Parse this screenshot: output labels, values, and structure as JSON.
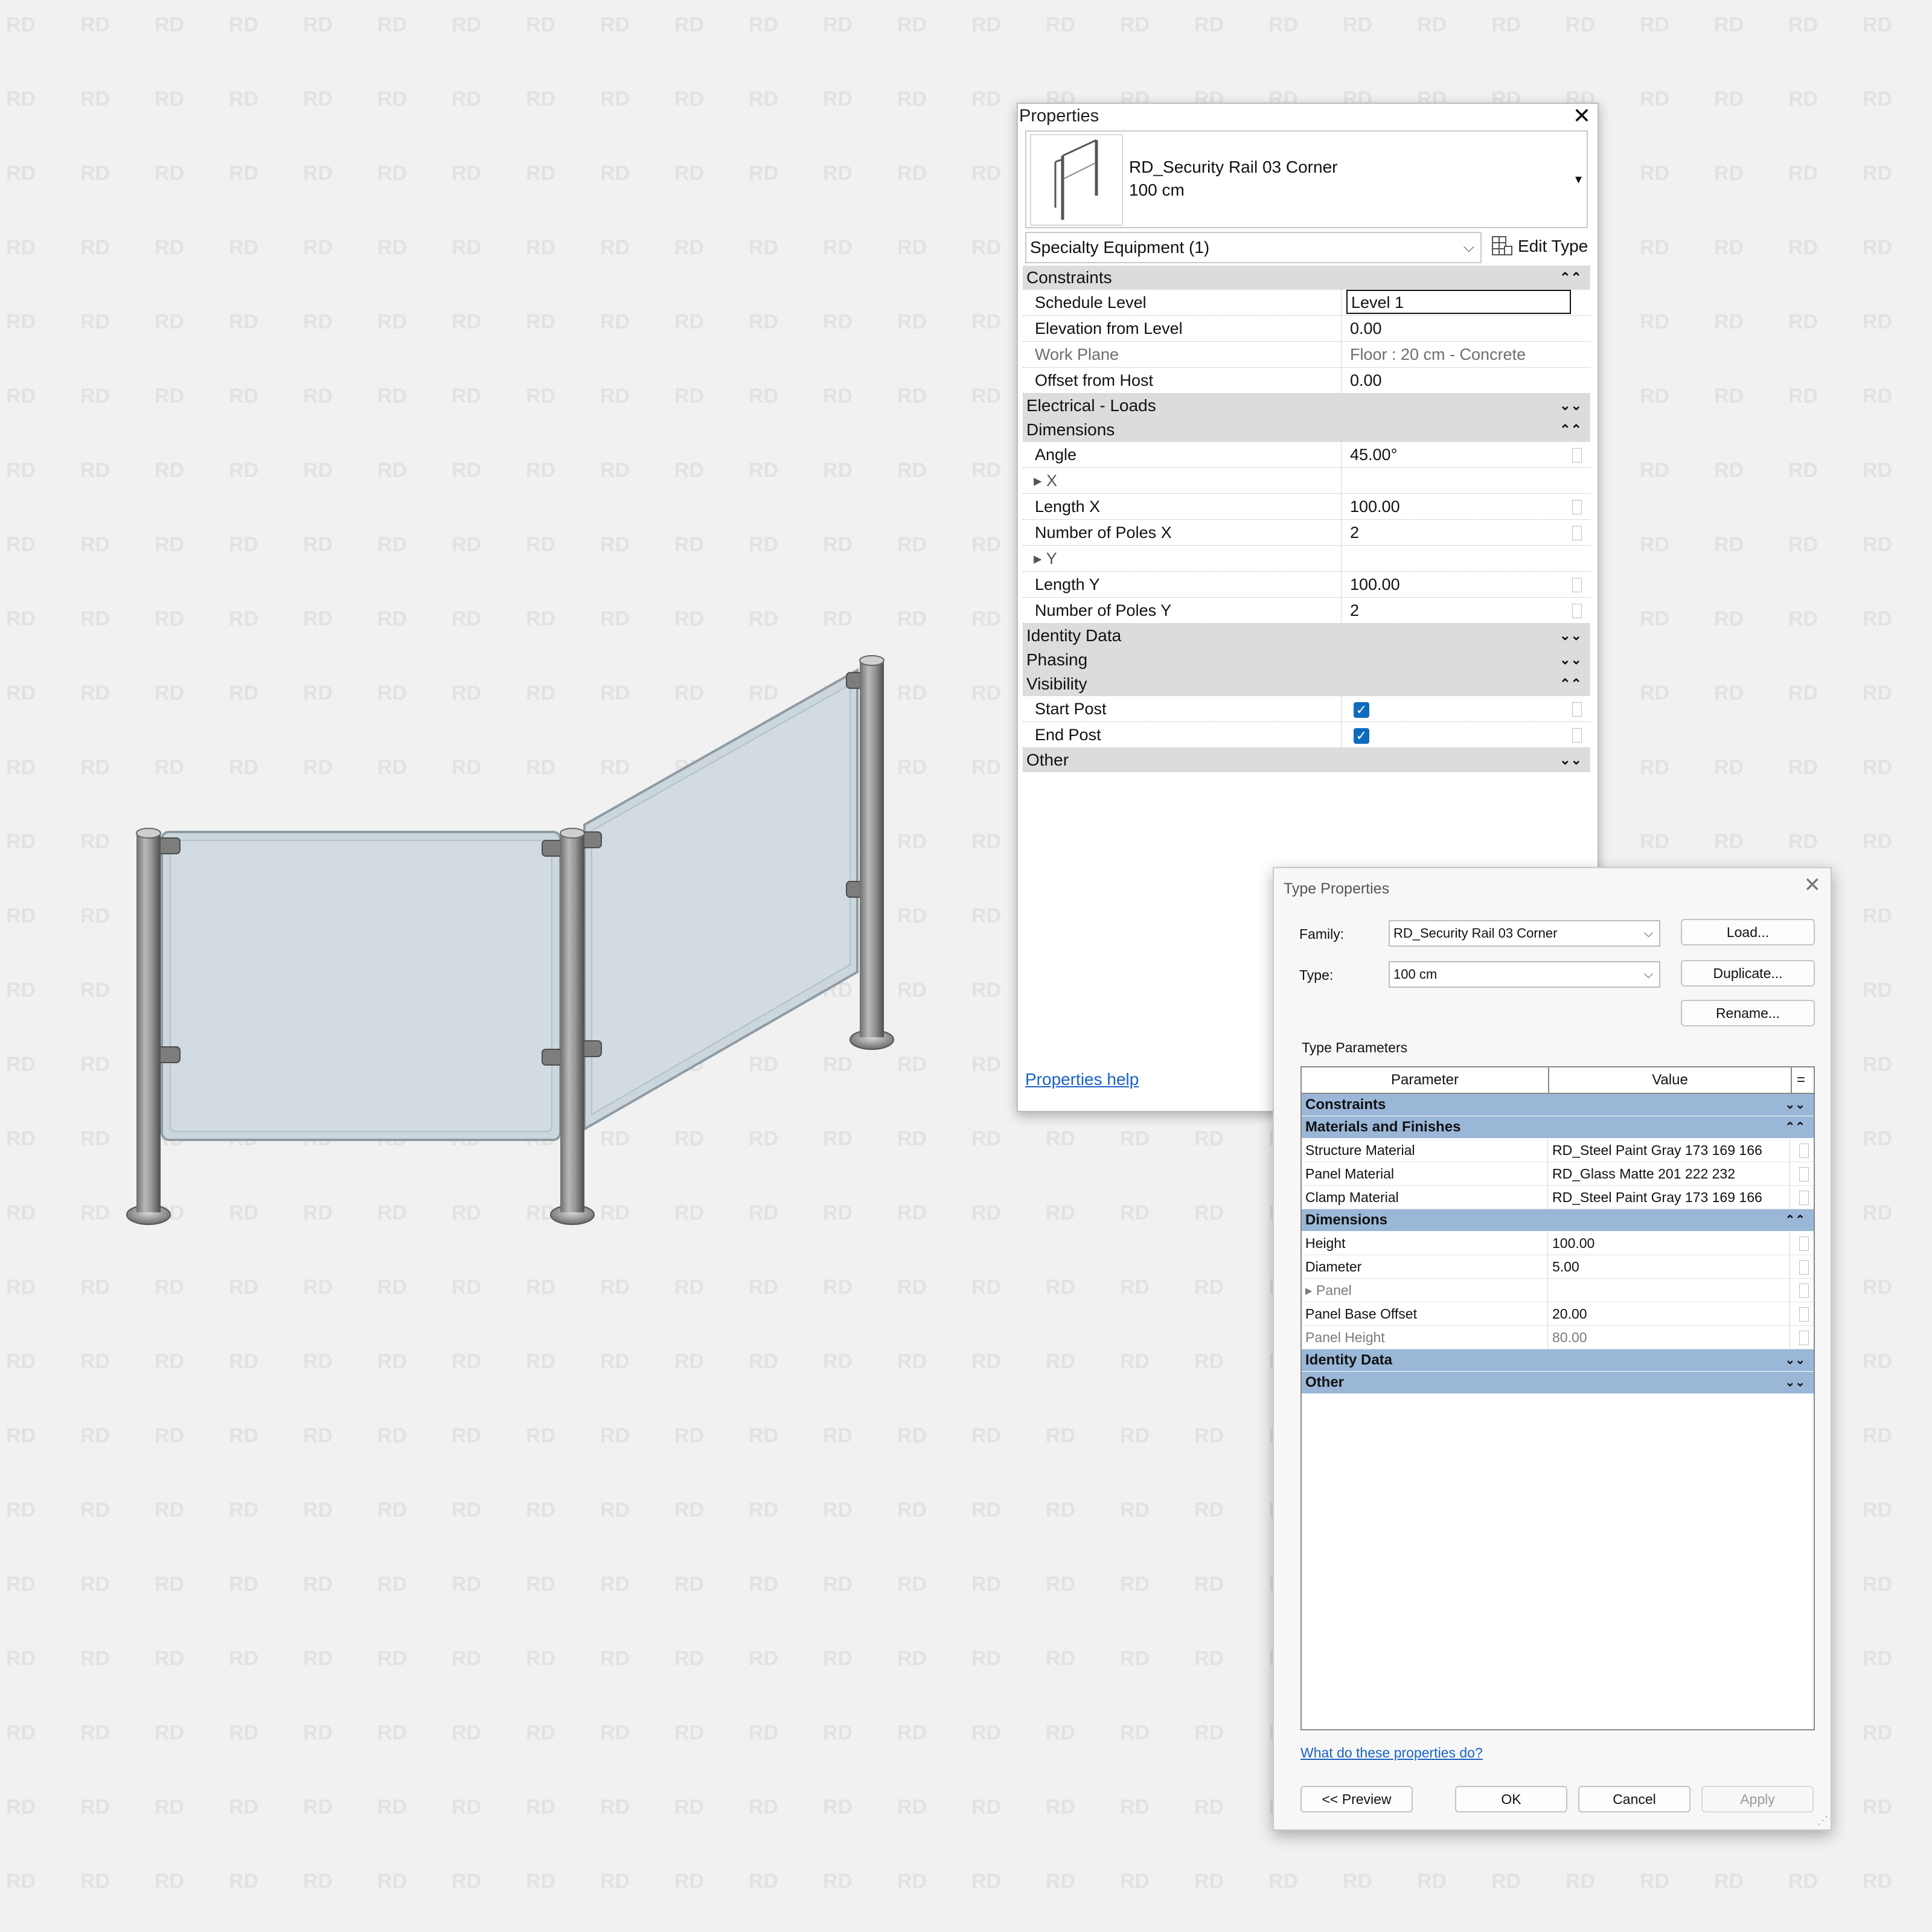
{
  "watermark": "RD",
  "properties": {
    "title": "Properties",
    "close_glyph": "✕",
    "family_name": "RD_Security Rail 03 Corner",
    "type_name": "100 cm",
    "type_dropdown_glyph": "▾",
    "category_filter": "Specialty Equipment (1)",
    "edit_type_label": "Edit Type",
    "categories": [
      {
        "label": "Constraints",
        "arrow": "⌃⌃",
        "rows": [
          {
            "name": "Schedule Level",
            "value": "Level 1",
            "editing": true
          },
          {
            "name": "Elevation from Level",
            "value": "0.00"
          },
          {
            "name": "Work Plane",
            "value": "Floor : 20 cm - Concrete",
            "readonly": true
          },
          {
            "name": "Offset from Host",
            "value": "0.00"
          }
        ]
      },
      {
        "label": "Electrical - Loads",
        "arrow": "⌄⌄",
        "rows": []
      },
      {
        "label": "Dimensions",
        "arrow": "⌃⌃",
        "rows": [
          {
            "name": "Angle",
            "value": "45.00°",
            "assoc": true
          },
          {
            "name": "▸ X",
            "value": "",
            "sub": true
          },
          {
            "name": "Length X",
            "value": "100.00",
            "assoc": true
          },
          {
            "name": "Number of Poles X",
            "value": "2",
            "assoc": true
          },
          {
            "name": "▸ Y",
            "value": "",
            "sub": true
          },
          {
            "name": "Length Y",
            "value": "100.00",
            "assoc": true
          },
          {
            "name": "Number of Poles Y",
            "value": "2",
            "assoc": true
          }
        ]
      },
      {
        "label": "Identity Data",
        "arrow": "⌄⌄",
        "rows": []
      },
      {
        "label": "Phasing",
        "arrow": "⌄⌄",
        "rows": []
      },
      {
        "label": "Visibility",
        "arrow": "⌃⌃",
        "rows": [
          {
            "name": "Start Post",
            "checked": true,
            "assoc": true
          },
          {
            "name": "End Post",
            "checked": true,
            "assoc": true
          }
        ]
      },
      {
        "label": "Other",
        "arrow": "⌄⌄",
        "rows": []
      }
    ],
    "help_link": "Properties help"
  },
  "type_properties": {
    "title": "Type Properties",
    "close_glyph": "✕",
    "family_label": "Family:",
    "family_value": "RD_Security Rail 03 Corner",
    "type_label": "Type:",
    "type_value": "100 cm",
    "load_button": "Load...",
    "duplicate_button": "Duplicate...",
    "rename_button": "Rename...",
    "section_label": "Type Parameters",
    "col_parameter": "Parameter",
    "col_value": "Value",
    "col_eq": "=",
    "categories": [
      {
        "label": "Constraints",
        "arrow": "⌄⌄",
        "rows": []
      },
      {
        "label": "Materials and Finishes",
        "arrow": "⌃⌃",
        "rows": [
          {
            "name": "Structure Material",
            "value": "RD_Steel Paint Gray 173 169 166"
          },
          {
            "name": "Panel Material",
            "value": "RD_Glass Matte 201 222 232"
          },
          {
            "name": "Clamp Material",
            "value": "RD_Steel Paint Gray 173 169 166"
          }
        ]
      },
      {
        "label": "Dimensions",
        "arrow": "⌃⌃",
        "rows": [
          {
            "name": "Height",
            "value": "100.00"
          },
          {
            "name": "Diameter",
            "value": "5.00"
          },
          {
            "name": "▸ Panel",
            "value": "",
            "readonly": true
          },
          {
            "name": "Panel Base Offset",
            "value": "20.00"
          },
          {
            "name": "Panel Height",
            "value": "80.00",
            "readonly": true
          }
        ]
      },
      {
        "label": "Identity Data",
        "arrow": "⌄⌄",
        "rows": []
      },
      {
        "label": "Other",
        "arrow": "⌄⌄",
        "rows": []
      }
    ],
    "help_link": "What do these properties do?",
    "preview_button": "<< Preview",
    "ok_button": "OK",
    "cancel_button": "Cancel",
    "apply_button": "Apply"
  }
}
